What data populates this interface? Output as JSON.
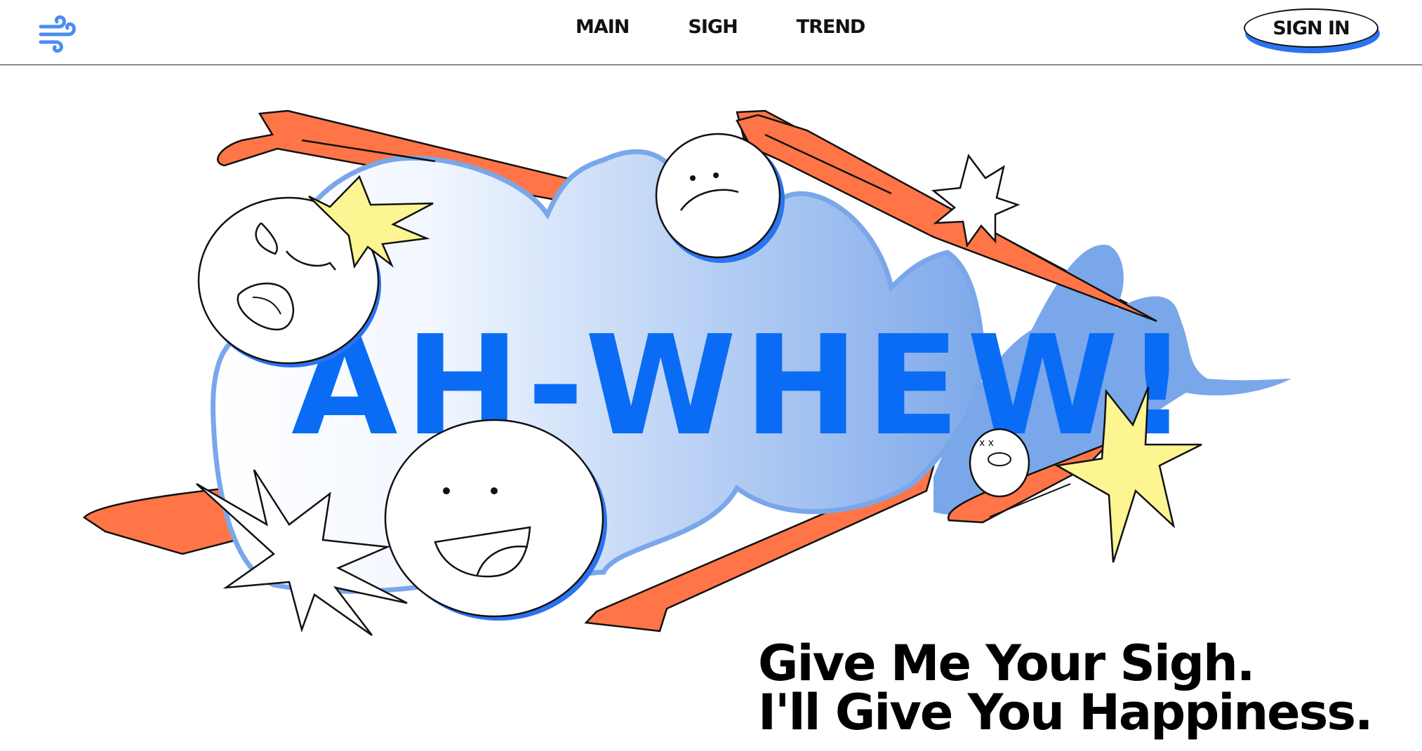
{
  "header": {
    "logo_icon": "wind-icon",
    "nav": [
      {
        "label": "MAIN"
      },
      {
        "label": "SIGH"
      },
      {
        "label": "TREND"
      }
    ],
    "signin_label": "SIGN IN"
  },
  "hero": {
    "headline": "AH-WHEW!",
    "tagline_line1": "Give Me Your Sigh.",
    "tagline_line2": "I'll Give You Happiness."
  },
  "colors": {
    "brand_blue": "#0a6cf5",
    "cloud_blue": "#7aa7ea",
    "streak_orange": "#ff7547",
    "star_yellow": "#fdf592",
    "text": "#000000"
  }
}
